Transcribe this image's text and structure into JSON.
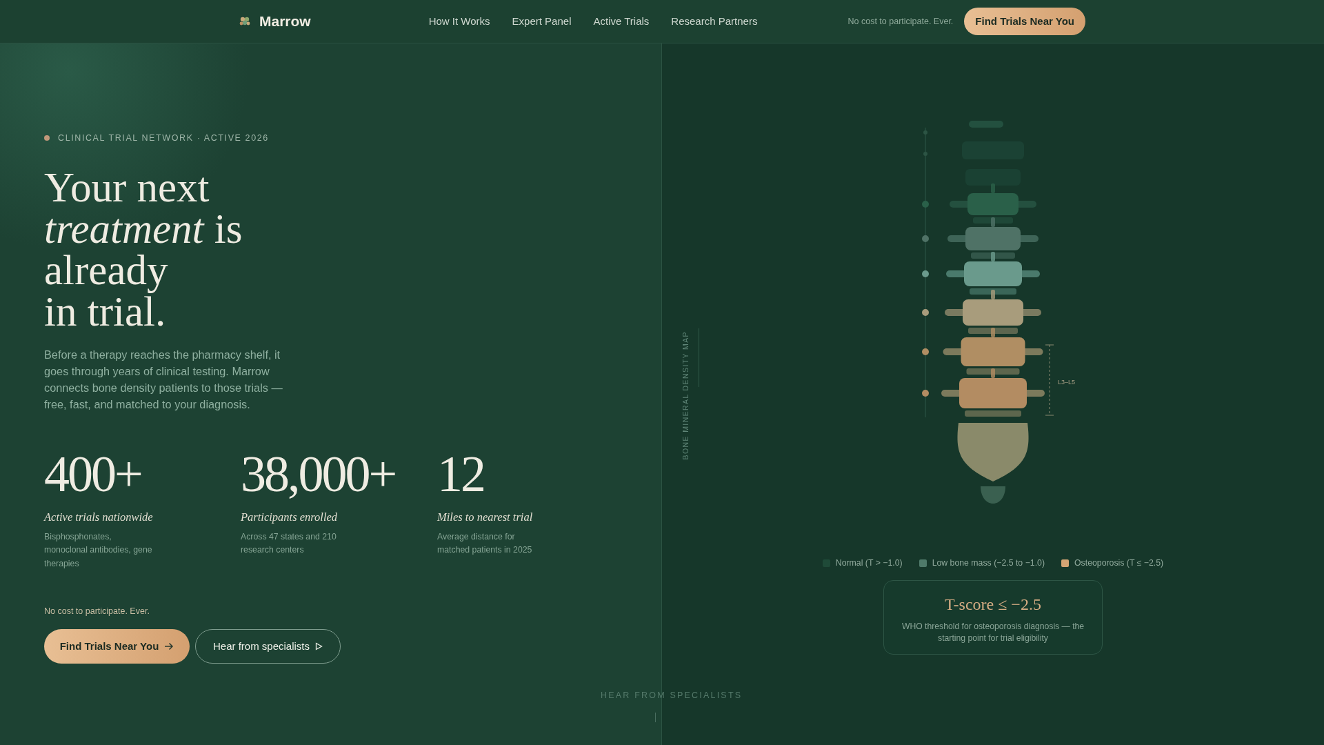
{
  "nav": {
    "brand": "Marrow",
    "links": [
      "How It Works",
      "Expert Panel",
      "Active Trials",
      "Research Partners"
    ],
    "note": "No cost to participate. Ever.",
    "cta": "Find Trials Near You"
  },
  "hero": {
    "eyebrow": "CLINICAL TRIAL NETWORK · ACTIVE 2026",
    "headline": "Your next\n*treatment* is already\nin trial.",
    "intro": "Before a therapy reaches the pharmacy shelf, it goes through years of clinical testing. Marrow connects bone density patients to those trials — free, fast, and matched to your diagnosis.",
    "stats": [
      {
        "value": "400+",
        "label": "Active trials nationwide",
        "detail": "Bisphosphonates, monoclonal antibodies, gene therapies"
      },
      {
        "value": "38,000+",
        "label": "Participants enrolled",
        "detail": "Across 47 states and 210 research centers"
      },
      {
        "value": "12",
        "label": "Miles to nearest trial",
        "detail": "Average distance for matched patients in 2025"
      }
    ],
    "note": "No cost to participate. Ever.",
    "primary_button": "Find Trials Near You",
    "secondary_button": "Hear from specialists"
  },
  "density_map": {
    "side_label": "BONE MINERAL DENSITY MAP",
    "bracket_label": "L3–L5",
    "legend": [
      {
        "label": "Normal (T > −1.0)",
        "color": "#1f4a38"
      },
      {
        "label": "Low bone mass (−2.5 to −1.0)",
        "color": "#4f7a6a"
      },
      {
        "label": "Osteoporosis (T ≤ −2.5)",
        "color": "#d4a574"
      }
    ],
    "callout": {
      "title": "T-score ≤ −2.5",
      "text": "WHO threshold for osteoporosis diagnosis — the starting point for trial eligibility"
    }
  },
  "scroll_hint": "HEAR FROM SPECIALISTS"
}
